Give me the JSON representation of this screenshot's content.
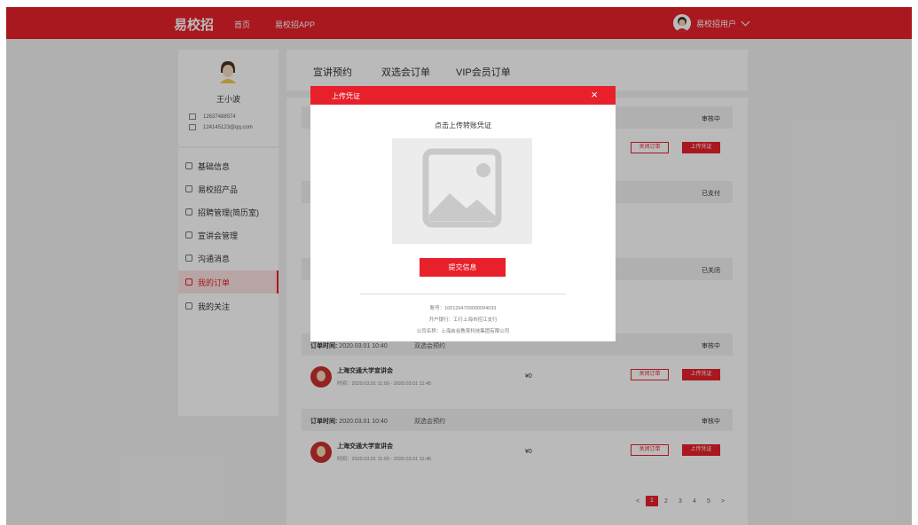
{
  "topbar": {
    "logo": "易校招",
    "nav_home": "首页",
    "nav_app": "易校招APP",
    "user_name": "易校招用户"
  },
  "profile": {
    "name": "王小波",
    "phone": "12637488574",
    "email": "124145123@qq.com"
  },
  "sidebar": {
    "items": [
      {
        "label": "基础信息"
      },
      {
        "label": "易校招产品"
      },
      {
        "label": "招聘管理(简历室)"
      },
      {
        "label": "宣讲会管理"
      },
      {
        "label": "沟通消息"
      },
      {
        "label": "我的订单"
      },
      {
        "label": "我的关注"
      }
    ]
  },
  "tabs": [
    "宣讲预约",
    "双选会订单",
    "VIP会员订单"
  ],
  "orders": [
    {
      "status": "审核中",
      "close_label": "关闭订单",
      "upload_label": "上传凭证"
    },
    {
      "status": "已支付"
    },
    {
      "status": "已关闭"
    },
    {
      "time_label": "订单时间:",
      "time": "2020.03.01 10:40",
      "type": "双选会预约",
      "status": "审核中",
      "title": "上海交通大学宣讲会",
      "session": "时间：2020.03.01 11:00 - 2020.03.01 11:45",
      "price": "¥0",
      "close_label": "关闭订单",
      "upload_label": "上传凭证"
    },
    {
      "time_label": "订单时间:",
      "time": "2020.03.01 10:40",
      "type": "双选会预约",
      "status": "审核中",
      "title": "上海交通大学宣讲会",
      "session": "时间：2020.03.01 11:00 - 2020.03.01 11:45",
      "price": "¥0",
      "close_label": "关闭订单",
      "upload_label": "上传凭证"
    }
  ],
  "pagination": {
    "prev": "<",
    "pages": [
      "1",
      "2",
      "3",
      "4",
      "5"
    ],
    "next": ">",
    "current": "1"
  },
  "modal": {
    "title": "上传凭证",
    "close": "×",
    "tip": "点击上传转账凭证",
    "submit": "提交信息",
    "account": "账号：1001264709000094033",
    "bank": "开户银行：工行上海市控江支行",
    "company": "公司名称：上海启谷教育科技集团有限公司"
  },
  "colors": {
    "brand": "#e8202b",
    "page_bg": "#f2f2f2",
    "active_menu_bg": "#fbe3e4"
  },
  "icons": {
    "phone": "phone-icon",
    "email": "mail-icon",
    "close": "close-icon",
    "chevron": "chevron-down-icon",
    "image_placeholder": "image-placeholder-icon"
  }
}
